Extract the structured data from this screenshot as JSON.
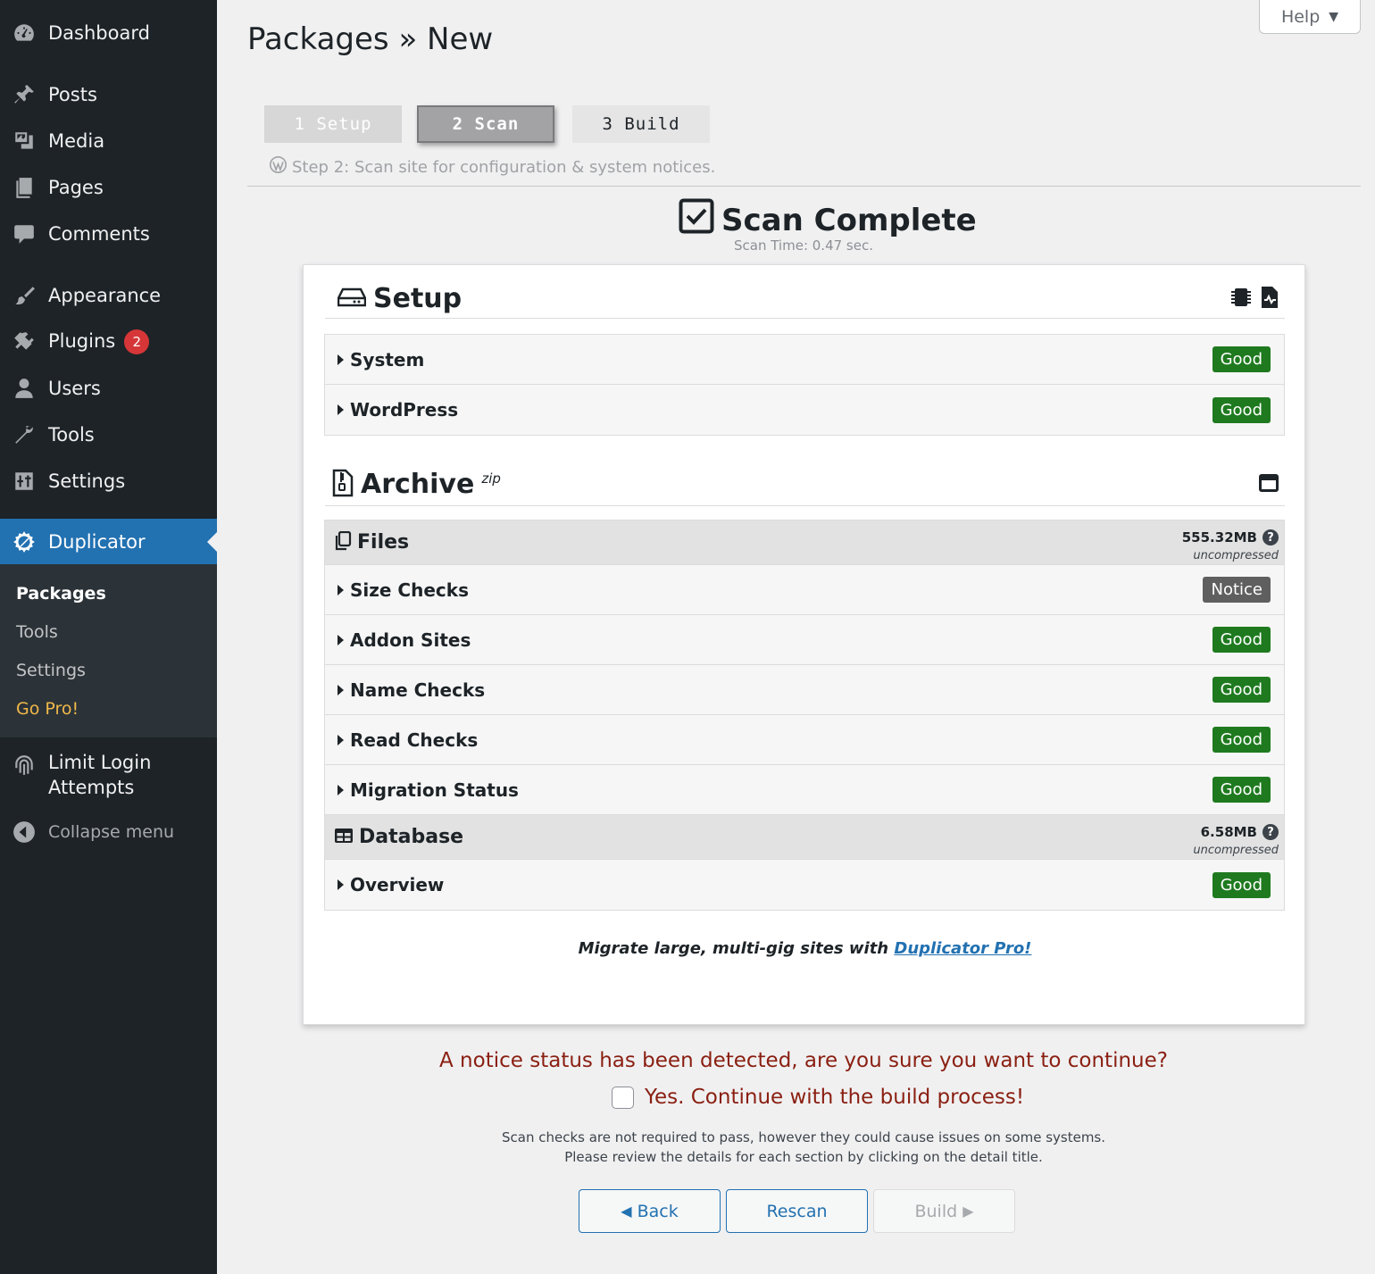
{
  "sidebar": {
    "items": [
      {
        "label": "Dashboard",
        "icon": "dashboard-icon"
      },
      {
        "label": "Posts",
        "icon": "pin-icon"
      },
      {
        "label": "Media",
        "icon": "media-icon"
      },
      {
        "label": "Pages",
        "icon": "pages-icon"
      },
      {
        "label": "Comments",
        "icon": "comment-icon"
      },
      {
        "label": "Appearance",
        "icon": "brush-icon"
      },
      {
        "label": "Plugins",
        "icon": "plugin-icon",
        "badge": "2"
      },
      {
        "label": "Users",
        "icon": "user-icon"
      },
      {
        "label": "Tools",
        "icon": "wrench-icon"
      },
      {
        "label": "Settings",
        "icon": "settings-icon"
      },
      {
        "label": "Duplicator",
        "icon": "duplicator-icon"
      },
      {
        "label": "Limit Login Attempts",
        "label_line1": "Limit Login",
        "label_line2": "Attempts",
        "icon": "fingerprint-icon"
      },
      {
        "label": "Collapse menu",
        "icon": "collapse-icon"
      }
    ],
    "submenu": [
      "Packages",
      "Tools",
      "Settings",
      "Go Pro!"
    ]
  },
  "help": {
    "label": "Help"
  },
  "page": {
    "title": "Packages » New"
  },
  "steps": {
    "step1": "1 Setup",
    "step2": "2 Scan",
    "step3": "3 Build",
    "description": "Step 2: Scan site for configuration & system notices."
  },
  "scan": {
    "title": "Scan Complete",
    "time": "Scan Time: 0.47 sec."
  },
  "setup": {
    "title": "Setup",
    "rows": [
      {
        "label": "System",
        "status": "Good"
      },
      {
        "label": "WordPress",
        "status": "Good"
      }
    ]
  },
  "archive": {
    "title": "Archive",
    "format": "zip",
    "files": {
      "title": "Files",
      "size": "555.32MB",
      "size_note": "uncompressed",
      "rows": [
        {
          "label": "Size Checks",
          "status": "Notice"
        },
        {
          "label": "Addon Sites",
          "status": "Good"
        },
        {
          "label": "Name Checks",
          "status": "Good"
        },
        {
          "label": "Read Checks",
          "status": "Good"
        },
        {
          "label": "Migration Status",
          "status": "Good"
        }
      ]
    },
    "database": {
      "title": "Database",
      "size": "6.58MB",
      "size_note": "uncompressed",
      "rows": [
        {
          "label": "Overview",
          "status": "Good"
        }
      ]
    }
  },
  "promo": {
    "text": "Migrate large, multi-gig sites with ",
    "link": "Duplicator Pro!"
  },
  "notice": {
    "question": "A notice status has been detected, are you sure you want to continue?",
    "checkbox_label": "Yes. Continue with the build process!",
    "info_line1": "Scan checks are not required to pass, however they could cause issues on some systems.",
    "info_line2": "Please review the details for each section by clicking on the detail title."
  },
  "buttons": {
    "back": "Back",
    "rescan": "Rescan",
    "build": "Build"
  },
  "colors": {
    "sidebar_bg": "#1d2327",
    "accent": "#2271b1",
    "good": "#1f7a1f",
    "notice": "#5f5f5f",
    "warning_text": "#8a1f11",
    "gopro": "#f0b849"
  }
}
